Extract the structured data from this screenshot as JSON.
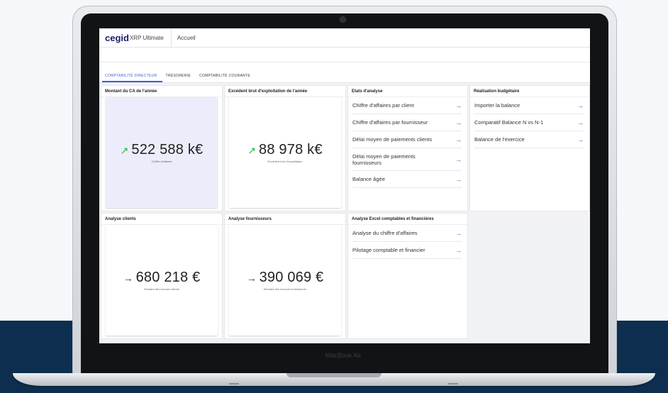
{
  "device": {
    "brand": "MacBook Air"
  },
  "app": {
    "logo_brand": "cegid",
    "logo_suffix": "XRP Ultimate",
    "home_tab": "Accueil"
  },
  "tabs": [
    "COMPTABILITÉ DIRECTEUR",
    "TRÉSORERIE",
    "COMPTABILITÉ COURANTE"
  ],
  "cards": {
    "ca": {
      "title": "Montant du CA de l'année",
      "value": "522 588 k€",
      "sub": "Chiffre d'affaires",
      "icon": "trend-up-icon"
    },
    "ebe": {
      "title": "Excédent brut d'exploitation de l'année",
      "value": "88 978 k€",
      "sub": "Excédent brut d'exploitation",
      "icon": "trend-up-icon"
    },
    "clients": {
      "title": "Analyse clients",
      "value": "680 218 €",
      "sub": "Montant des excours clients",
      "icon": "arrow-right-icon"
    },
    "fournisseurs": {
      "title": "Analyse fournisseurs",
      "value": "390 069 €",
      "sub": "Montant des excours fournisseurs",
      "icon": "arrow-right-icon"
    }
  },
  "etats": {
    "title": "Etats d'analyse",
    "items": [
      "Chiffre d'affaires par client",
      "Chiffre d'affaires par fournisseur",
      "Délai moyen de paiements clients",
      "Délai moyen de paiements fournisseurs",
      "Balance âgée"
    ]
  },
  "budget": {
    "title": "Réalisation budgétaire",
    "items": [
      "Importer la balance",
      "Comparatif Balance N vs N-1",
      "Balance de l'exercice"
    ]
  },
  "excel": {
    "title": "Analyse Excel comptables et financières",
    "items": [
      "Analyse du chiffre d'affaires",
      "Pilotage comptable et financier"
    ]
  },
  "colors": {
    "accent": "#3b5bdb",
    "navy": "#0d2e4e",
    "trend_green": "#2fb344"
  }
}
